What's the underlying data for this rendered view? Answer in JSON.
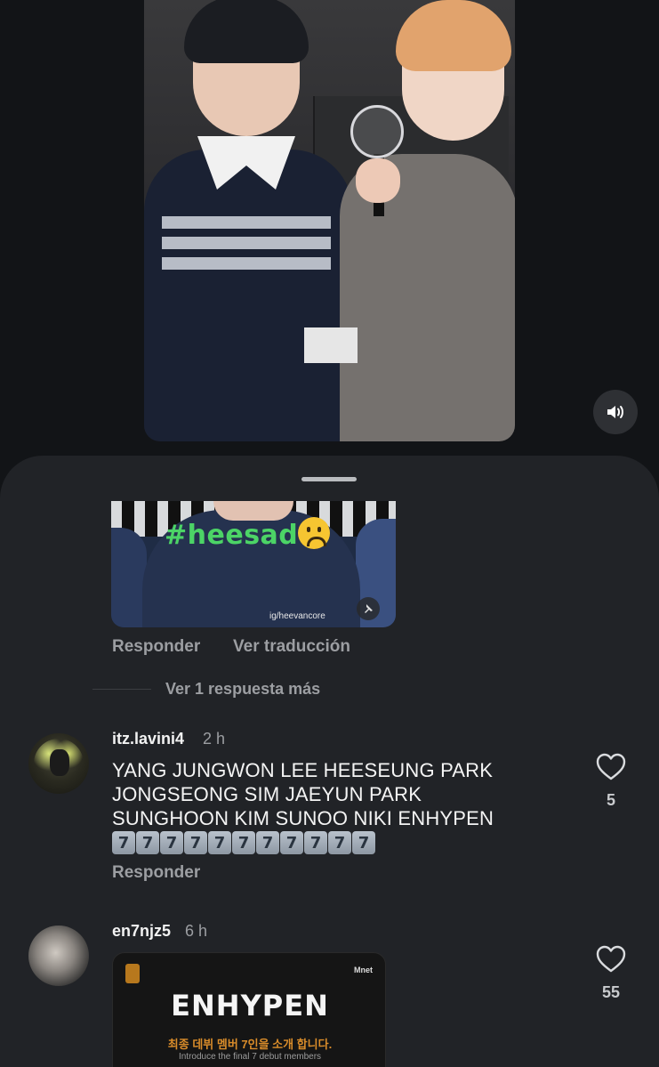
{
  "video": {
    "volume_icon": "speaker-icon"
  },
  "gif": {
    "hashtag": "#heesad",
    "credit": "ig/heevancore",
    "pin_icon": "pin-icon"
  },
  "comment_prev": {
    "reply_label": "Responder",
    "translate_label": "Ver traducción",
    "view_more_label": "Ver 1 respuesta más"
  },
  "comments": [
    {
      "username": "itz.lavini4",
      "time": "2 h",
      "text": "YANG JUNGWON LEE HEESEUNG PARK JONGSEONG SIM JAEYUN PARK SUNGHOON KIM SUNOO NIKI ENHYPEN",
      "emoji_digits": [
        "7",
        "7",
        "7",
        "7",
        "7",
        "7",
        "7",
        "7",
        "7",
        "7",
        "7"
      ],
      "reply_label": "Responder",
      "likes": "5"
    },
    {
      "username": "en7njz5",
      "time": "6 h",
      "likes": "55",
      "image": {
        "brand": "Mnet",
        "title": "ENHYPEN",
        "subtitle": "최종 데뷔 멤버 7인을 소개 합니다.",
        "caption": "Introduce the final 7 debut members"
      }
    }
  ]
}
